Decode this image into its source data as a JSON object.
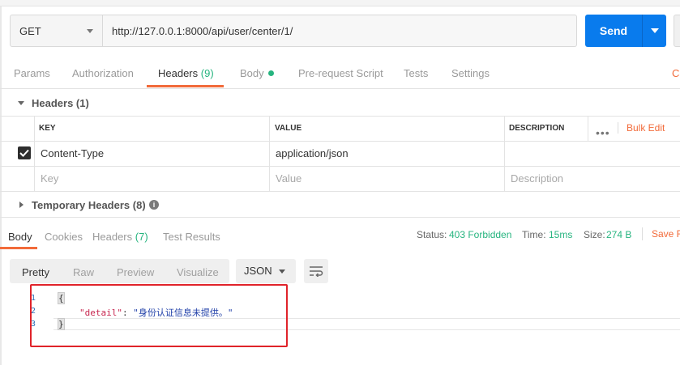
{
  "request": {
    "method": "GET",
    "url": "http://127.0.0.1:8000/api/user/center/1/",
    "send_label": "Send"
  },
  "request_tabs": {
    "params": "Params",
    "authorization": "Authorization",
    "headers": "Headers",
    "headers_count": "(9)",
    "body": "Body",
    "prerequest": "Pre-request Script",
    "tests": "Tests",
    "settings": "Settings",
    "cookies_stub": "Co"
  },
  "headers_section": {
    "title": "Headers (1)",
    "columns": {
      "key": "KEY",
      "value": "VALUE",
      "description": "DESCRIPTION"
    },
    "bulk_edit": "Bulk Edit",
    "rows": [
      {
        "key": "Content-Type",
        "value": "application/json",
        "checked": true
      }
    ],
    "placeholder": {
      "key": "Key",
      "value": "Value",
      "description": "Description"
    },
    "temporary_title": "Temporary Headers (8)"
  },
  "response": {
    "tabs": {
      "body": "Body",
      "cookies": "Cookies",
      "headers": "Headers",
      "headers_count": "(7)",
      "test_results": "Test Results"
    },
    "status_label": "Status:",
    "status_value": "403 Forbidden",
    "time_label": "Time:",
    "time_value": "15ms",
    "size_label": "Size:",
    "size_value": "274 B",
    "save_label": "Save R",
    "view_tabs": [
      "Pretty",
      "Raw",
      "Preview",
      "Visualize"
    ],
    "format": "JSON",
    "code": {
      "line_numbers": [
        "1",
        "2",
        "3"
      ],
      "open_brace": "{",
      "key": "\"detail\"",
      "colon": ": ",
      "value": "\"身份认证信息未提供。\"",
      "close_brace": "}"
    }
  },
  "colors": {
    "accent": "#f26b3a",
    "send_blue": "#097bed",
    "success_green": "#26b47f",
    "highlight_red": "#e0232a"
  }
}
